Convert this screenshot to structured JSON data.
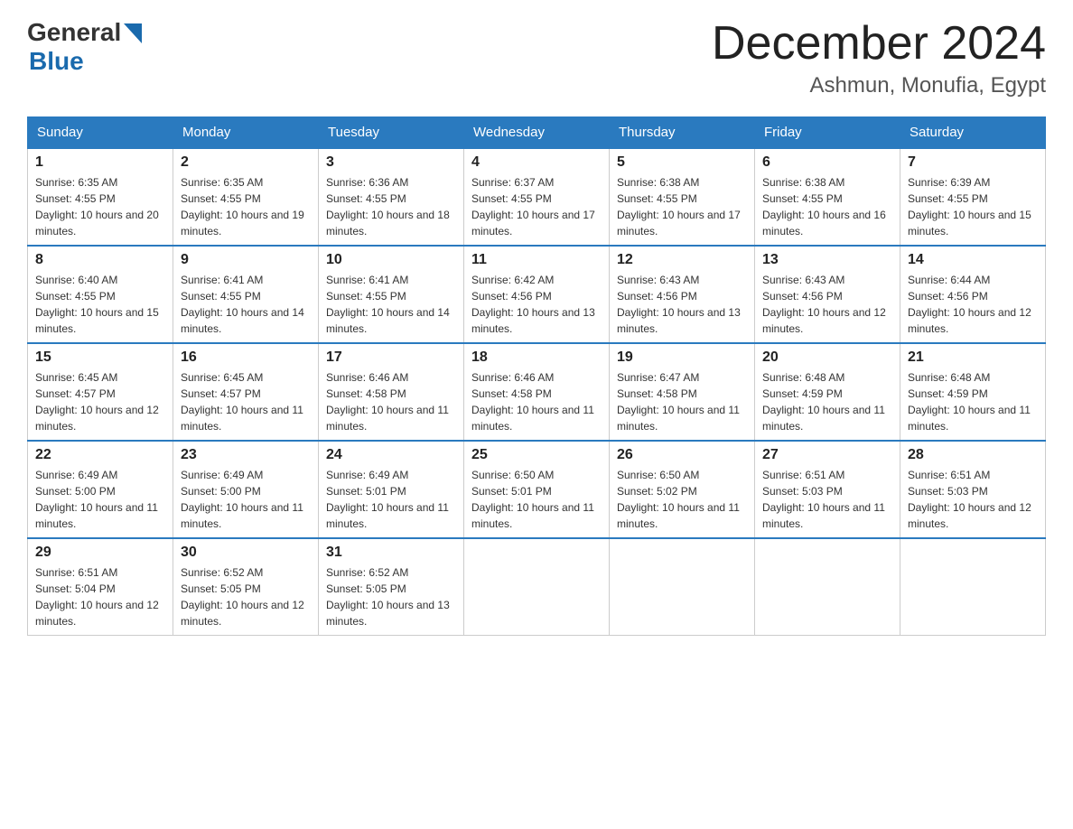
{
  "header": {
    "logo_general": "General",
    "logo_blue": "Blue",
    "month_title": "December 2024",
    "location": "Ashmun, Monufia, Egypt"
  },
  "weekdays": [
    "Sunday",
    "Monday",
    "Tuesday",
    "Wednesday",
    "Thursday",
    "Friday",
    "Saturday"
  ],
  "weeks": [
    [
      {
        "day": "1",
        "sunrise": "6:35 AM",
        "sunset": "4:55 PM",
        "daylight": "10 hours and 20 minutes."
      },
      {
        "day": "2",
        "sunrise": "6:35 AM",
        "sunset": "4:55 PM",
        "daylight": "10 hours and 19 minutes."
      },
      {
        "day": "3",
        "sunrise": "6:36 AM",
        "sunset": "4:55 PM",
        "daylight": "10 hours and 18 minutes."
      },
      {
        "day": "4",
        "sunrise": "6:37 AM",
        "sunset": "4:55 PM",
        "daylight": "10 hours and 17 minutes."
      },
      {
        "day": "5",
        "sunrise": "6:38 AM",
        "sunset": "4:55 PM",
        "daylight": "10 hours and 17 minutes."
      },
      {
        "day": "6",
        "sunrise": "6:38 AM",
        "sunset": "4:55 PM",
        "daylight": "10 hours and 16 minutes."
      },
      {
        "day": "7",
        "sunrise": "6:39 AM",
        "sunset": "4:55 PM",
        "daylight": "10 hours and 15 minutes."
      }
    ],
    [
      {
        "day": "8",
        "sunrise": "6:40 AM",
        "sunset": "4:55 PM",
        "daylight": "10 hours and 15 minutes."
      },
      {
        "day": "9",
        "sunrise": "6:41 AM",
        "sunset": "4:55 PM",
        "daylight": "10 hours and 14 minutes."
      },
      {
        "day": "10",
        "sunrise": "6:41 AM",
        "sunset": "4:55 PM",
        "daylight": "10 hours and 14 minutes."
      },
      {
        "day": "11",
        "sunrise": "6:42 AM",
        "sunset": "4:56 PM",
        "daylight": "10 hours and 13 minutes."
      },
      {
        "day": "12",
        "sunrise": "6:43 AM",
        "sunset": "4:56 PM",
        "daylight": "10 hours and 13 minutes."
      },
      {
        "day": "13",
        "sunrise": "6:43 AM",
        "sunset": "4:56 PM",
        "daylight": "10 hours and 12 minutes."
      },
      {
        "day": "14",
        "sunrise": "6:44 AM",
        "sunset": "4:56 PM",
        "daylight": "10 hours and 12 minutes."
      }
    ],
    [
      {
        "day": "15",
        "sunrise": "6:45 AM",
        "sunset": "4:57 PM",
        "daylight": "10 hours and 12 minutes."
      },
      {
        "day": "16",
        "sunrise": "6:45 AM",
        "sunset": "4:57 PM",
        "daylight": "10 hours and 11 minutes."
      },
      {
        "day": "17",
        "sunrise": "6:46 AM",
        "sunset": "4:58 PM",
        "daylight": "10 hours and 11 minutes."
      },
      {
        "day": "18",
        "sunrise": "6:46 AM",
        "sunset": "4:58 PM",
        "daylight": "10 hours and 11 minutes."
      },
      {
        "day": "19",
        "sunrise": "6:47 AM",
        "sunset": "4:58 PM",
        "daylight": "10 hours and 11 minutes."
      },
      {
        "day": "20",
        "sunrise": "6:48 AM",
        "sunset": "4:59 PM",
        "daylight": "10 hours and 11 minutes."
      },
      {
        "day": "21",
        "sunrise": "6:48 AM",
        "sunset": "4:59 PM",
        "daylight": "10 hours and 11 minutes."
      }
    ],
    [
      {
        "day": "22",
        "sunrise": "6:49 AM",
        "sunset": "5:00 PM",
        "daylight": "10 hours and 11 minutes."
      },
      {
        "day": "23",
        "sunrise": "6:49 AM",
        "sunset": "5:00 PM",
        "daylight": "10 hours and 11 minutes."
      },
      {
        "day": "24",
        "sunrise": "6:49 AM",
        "sunset": "5:01 PM",
        "daylight": "10 hours and 11 minutes."
      },
      {
        "day": "25",
        "sunrise": "6:50 AM",
        "sunset": "5:01 PM",
        "daylight": "10 hours and 11 minutes."
      },
      {
        "day": "26",
        "sunrise": "6:50 AM",
        "sunset": "5:02 PM",
        "daylight": "10 hours and 11 minutes."
      },
      {
        "day": "27",
        "sunrise": "6:51 AM",
        "sunset": "5:03 PM",
        "daylight": "10 hours and 11 minutes."
      },
      {
        "day": "28",
        "sunrise": "6:51 AM",
        "sunset": "5:03 PM",
        "daylight": "10 hours and 12 minutes."
      }
    ],
    [
      {
        "day": "29",
        "sunrise": "6:51 AM",
        "sunset": "5:04 PM",
        "daylight": "10 hours and 12 minutes."
      },
      {
        "day": "30",
        "sunrise": "6:52 AM",
        "sunset": "5:05 PM",
        "daylight": "10 hours and 12 minutes."
      },
      {
        "day": "31",
        "sunrise": "6:52 AM",
        "sunset": "5:05 PM",
        "daylight": "10 hours and 13 minutes."
      },
      null,
      null,
      null,
      null
    ]
  ]
}
